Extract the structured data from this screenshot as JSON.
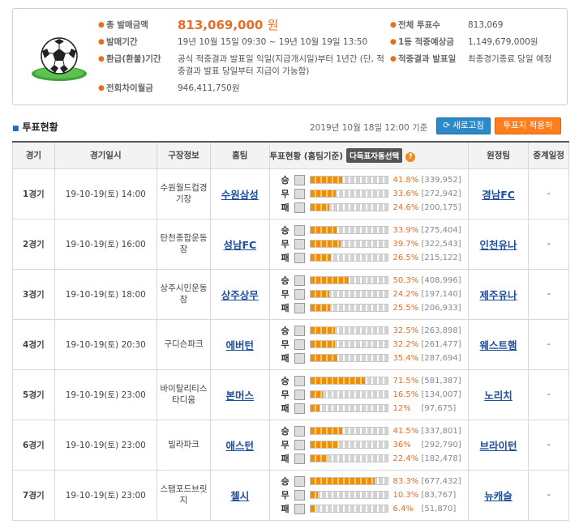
{
  "summary": {
    "total_sales_label": "총 발매금액",
    "total_sales_value": "813,069,000",
    "total_sales_unit": "원",
    "period_label": "발매기간",
    "period_value": "19년 10월 15일 09:30 ~ 19년 10월 19일 13:50",
    "refund_label": "환급(환불)기간",
    "refund_value": "공식 적중결과 발표일 익일(지급개시일)부터 1년간 (단, 적중결과 발표 당일부터 지급이 가능함)",
    "diff_label": "전회차이월금",
    "diff_value": "946,411,750원",
    "total_votes_label": "전체 투표수",
    "total_votes_value": "813,069",
    "first_prize_label": "1등 적중예상금",
    "first_prize_value": "1,149,679,000원",
    "result_label": "적중결과 발표일",
    "result_value": "최종경기종료 당일 예정"
  },
  "section": {
    "title": "투표현황",
    "timestamp": "2019년 10월 18일 12:00 기준",
    "refresh_button": "새로고침",
    "apply_button": "투표지 적용하기"
  },
  "table": {
    "headers": {
      "round": "경기",
      "datetime": "경기일시",
      "venue": "구장정보",
      "home": "홈팀",
      "vote": "투표현황 (홈팀기준)",
      "auto_select": "다득표자동선택",
      "help": "?",
      "away": "원정팀",
      "broadcast": "중계일정"
    },
    "outcome_labels": [
      "승",
      "무",
      "패"
    ],
    "rows": [
      {
        "round": "1경기",
        "datetime": "19-10-19(토) 14:00",
        "venue": "수원월드컵경기장",
        "home": "수원삼성",
        "away": "경남FC",
        "broadcast": "-",
        "votes": [
          {
            "pct": "41.8%",
            "count": "[339,952]",
            "value": 41.8
          },
          {
            "pct": "33.6%",
            "count": "[272,942]",
            "value": 33.6
          },
          {
            "pct": "24.6%",
            "count": "[200,175]",
            "value": 24.6
          }
        ]
      },
      {
        "round": "2경기",
        "datetime": "19-10-19(토) 16:00",
        "venue": "탄천종합운동장",
        "home": "성남FC",
        "away": "인천유나",
        "broadcast": "-",
        "votes": [
          {
            "pct": "33.9%",
            "count": "[275,404]",
            "value": 33.9
          },
          {
            "pct": "39.7%",
            "count": "[322,543]",
            "value": 39.7
          },
          {
            "pct": "26.5%",
            "count": "[215,122]",
            "value": 26.5
          }
        ]
      },
      {
        "round": "3경기",
        "datetime": "19-10-19(토) 18:00",
        "venue": "상주시민운동장",
        "home": "상주상무",
        "away": "제주유나",
        "broadcast": "-",
        "votes": [
          {
            "pct": "50.3%",
            "count": "[408,996]",
            "value": 50.3
          },
          {
            "pct": "24.2%",
            "count": "[197,140]",
            "value": 24.2
          },
          {
            "pct": "25.5%",
            "count": "[206,933]",
            "value": 25.5
          }
        ]
      },
      {
        "round": "4경기",
        "datetime": "19-10-19(토) 20:30",
        "venue": "구디슨파크",
        "home": "에버턴",
        "away": "웨스트햄",
        "broadcast": "-",
        "votes": [
          {
            "pct": "32.5%",
            "count": "[263,898]",
            "value": 32.5
          },
          {
            "pct": "32.2%",
            "count": "[261,477]",
            "value": 32.2
          },
          {
            "pct": "35.4%",
            "count": "[287,694]",
            "value": 35.4
          }
        ]
      },
      {
        "round": "5경기",
        "datetime": "19-10-19(토) 23:00",
        "venue": "바이탈리티스타디움",
        "home": "본머스",
        "away": "노리치",
        "broadcast": "-",
        "votes": [
          {
            "pct": "71.5%",
            "count": "[581,387]",
            "value": 71.5
          },
          {
            "pct": "16.5%",
            "count": "[134,007]",
            "value": 16.5
          },
          {
            "pct": "12%",
            "count": "[97,675]",
            "value": 12
          }
        ]
      },
      {
        "round": "6경기",
        "datetime": "19-10-19(토) 23:00",
        "venue": "빌라파크",
        "home": "애스턴",
        "away": "브라이턴",
        "broadcast": "-",
        "votes": [
          {
            "pct": "41.5%",
            "count": "[337,801]",
            "value": 41.5
          },
          {
            "pct": "36%",
            "count": "[292,790]",
            "value": 36
          },
          {
            "pct": "22.4%",
            "count": "[182,478]",
            "value": 22.4
          }
        ]
      },
      {
        "round": "7경기",
        "datetime": "19-10-19(토) 23:00",
        "venue": "스탬포드브릿지",
        "home": "첼시",
        "away": "뉴캐슬",
        "broadcast": "-",
        "votes": [
          {
            "pct": "83.3%",
            "count": "[677,432]",
            "value": 83.3
          },
          {
            "pct": "10.3%",
            "count": "[83,767]",
            "value": 10.3
          },
          {
            "pct": "6.4%",
            "count": "[51,870]",
            "value": 6.4
          }
        ]
      }
    ]
  }
}
